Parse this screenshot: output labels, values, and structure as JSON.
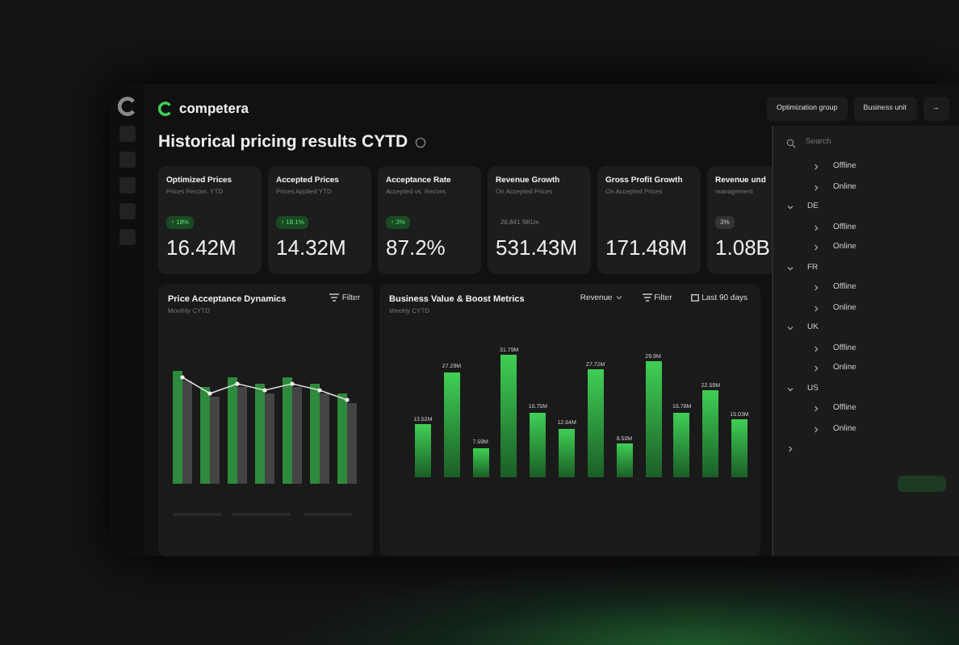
{
  "brand": "competera",
  "page_title": "Historical pricing results CYTD",
  "header_buttons": [
    {
      "label": "Optimization group"
    },
    {
      "label": "Business unit"
    },
    {
      "label": "→"
    }
  ],
  "cards": [
    {
      "title": "Optimized Prices",
      "subtitle": "Prices Recom. YTD",
      "badge": "↑ 18%",
      "badge_positive": true,
      "value": "16.42M"
    },
    {
      "title": "Accepted Prices",
      "subtitle": "Prices Applied YTD",
      "badge": "↑ 18.1%",
      "badge_positive": true,
      "value": "14.32M"
    },
    {
      "title": "Acceptance Rate",
      "subtitle": "Accepted vs. Recom.",
      "badge": "↑ 3%",
      "badge_positive": true,
      "value": "87.2%"
    },
    {
      "title": "Revenue Growth",
      "subtitle": "On Accepted Prices",
      "badge": "26,841 SKUs",
      "badge_positive": false,
      "badge_boxed": false,
      "value": "531.43M"
    },
    {
      "title": "Gross Profit Growth",
      "subtitle": "On Accepted Prices",
      "value": "171.48M"
    },
    {
      "title": "Revenue und",
      "subtitle": "management",
      "badge": "3%",
      "badge_positive": false,
      "badge_boxed": true,
      "value": "1.08B"
    }
  ],
  "left_chart": {
    "title": "Price Acceptance Dynamics",
    "subtitle": "Monthly CYTD",
    "filter": "Filter"
  },
  "right_chart": {
    "title": "Business Value & Boost Metrics",
    "subtitle": "Weekly CYTD",
    "metric": "Revenue",
    "filter": "Filter",
    "range": "Last 90 days",
    "bar_labels": [
      "13.52M",
      "27.29M",
      "7.59M",
      "31.79M",
      "16.75M",
      "12.64M",
      "27.72M",
      "8.50M",
      "29.9M",
      "16.78M",
      "22.59M",
      "15.03M"
    ]
  },
  "dropdown": {
    "search_placeholder": "Search",
    "items": [
      {
        "children": [
          {
            "label": "Offline"
          },
          {
            "label": "Online"
          }
        ]
      },
      {
        "label": "DE",
        "expanded": true,
        "children": [
          {
            "label": "Offline"
          },
          {
            "label": "Online"
          }
        ]
      },
      {
        "label": "FR",
        "expanded": true,
        "children": [
          {
            "label": "Offline"
          },
          {
            "label": "Online"
          }
        ]
      },
      {
        "label": "UK",
        "expanded": true,
        "children": [
          {
            "label": "Offline"
          },
          {
            "label": "Online"
          }
        ]
      },
      {
        "label": "US",
        "expanded": true,
        "children": [
          {
            "label": "Offline"
          },
          {
            "label": "Online"
          }
        ]
      },
      {
        "expanded": false
      }
    ]
  }
}
